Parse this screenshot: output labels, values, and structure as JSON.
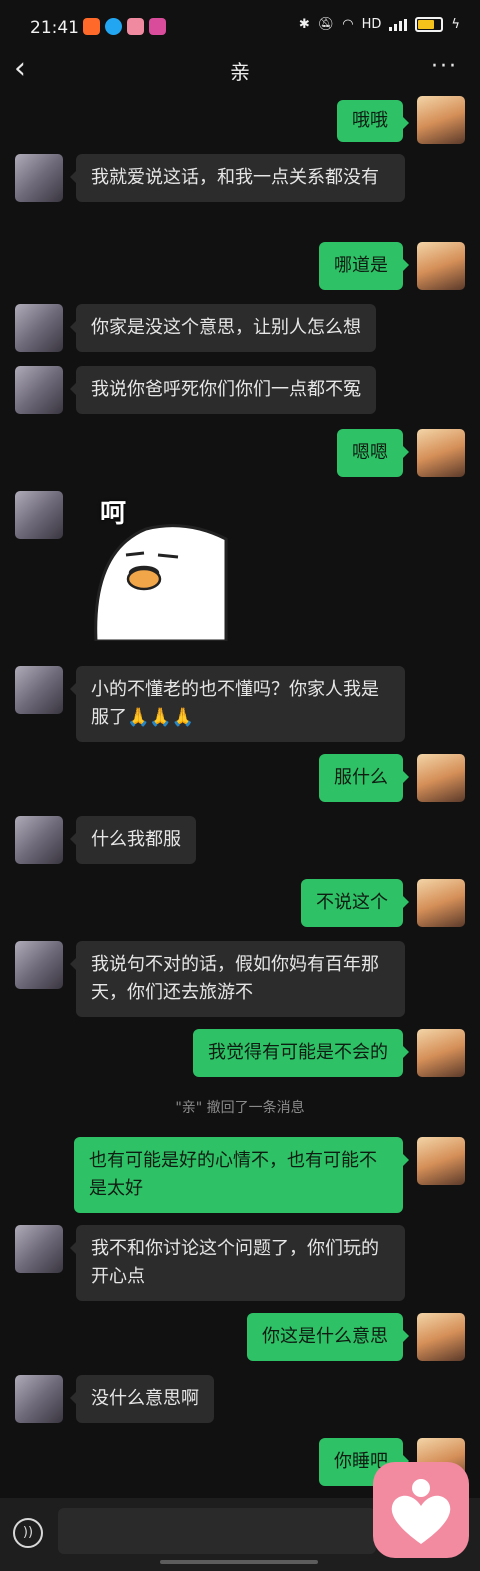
{
  "status_bar": {
    "time": "21:41",
    "network": "HD"
  },
  "header": {
    "title": "亲",
    "back_symbol": "‹",
    "more_symbol": "···"
  },
  "messages": [
    {
      "from": "me",
      "text": "哦哦"
    },
    {
      "from": "them",
      "text": "我就爱说这话，和我一点关系都没有"
    },
    {
      "from": "me",
      "text": "哪道是"
    },
    {
      "from": "them",
      "text": "你家是没这个意思，让别人怎么想"
    },
    {
      "from": "them",
      "text": "我说你爸呼死你们你们一点都不冤"
    },
    {
      "from": "me",
      "text": "嗯嗯"
    },
    {
      "from": "them",
      "sticker": "duck-sticker",
      "sticker_text": "呵"
    },
    {
      "from": "them",
      "text": "小的不懂老的也不懂吗？你家人我是服了🙏🙏🙏"
    },
    {
      "from": "me",
      "text": "服什么"
    },
    {
      "from": "them",
      "text": "什么我都服"
    },
    {
      "from": "me",
      "text": "不说这个"
    },
    {
      "from": "them",
      "text": "我说句不对的话，假如你妈有百年那天，你们还去旅游不"
    },
    {
      "from": "me",
      "text": "我觉得有可能是不会的"
    },
    {
      "system": "\"亲\" 撤回了一条消息"
    },
    {
      "from": "me",
      "text": "也有可能是好的心情不，也有可能不是太好"
    },
    {
      "from": "them",
      "text": "我不和你讨论这个问题了，你们玩的开心点"
    },
    {
      "from": "me",
      "text": "你这是什么意思"
    },
    {
      "from": "them",
      "text": "没什么意思啊"
    },
    {
      "from": "me",
      "text": "你睡吧"
    }
  ],
  "colors": {
    "my_bubble": "#2ec166",
    "their_bubble": "#2c2c2c",
    "background": "#111111"
  }
}
